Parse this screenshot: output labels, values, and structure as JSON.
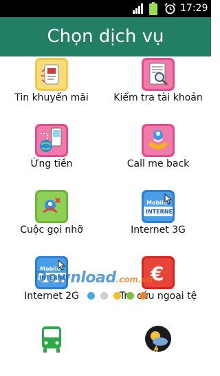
{
  "status_bar": {
    "time": "17:29",
    "icons": [
      "signal-icon",
      "battery-icon",
      "alarm-clock-icon"
    ]
  },
  "header": {
    "title": "Chọn dịch vụ"
  },
  "services": [
    {
      "label": "Tin khuyến mãi",
      "icon": "sim-card-promo-icon"
    },
    {
      "label": "Kiểm tra tài khoản",
      "icon": "document-magnifier-icon"
    },
    {
      "label": "Ứng tiền",
      "icon": "phone-globe-advance-icon"
    },
    {
      "label": "Call me back",
      "icon": "callback-handset-icon"
    },
    {
      "label": "Cuộc gọi nhỡ",
      "icon": "missed-call-icon"
    },
    {
      "label": "Internet 3G",
      "icon": "mobile-internet-3g-icon"
    },
    {
      "label": "Internet 2G",
      "icon": "mobile-internet-2g-icon"
    },
    {
      "label": "Tra cứu ngoại tệ",
      "icon": "euro-currency-icon"
    },
    {
      "label": "",
      "icon": "bus-icon"
    },
    {
      "label": "",
      "icon": "weather-icon"
    }
  ],
  "watermark": {
    "text": "Download",
    "suffix": ".com.vn"
  },
  "page_dots": {
    "colors": [
      "#4aa8e0",
      "#d0d0d0",
      "#f0c030",
      "#80c040",
      "#f08030"
    ]
  },
  "colors": {
    "header_bg": "#227f66",
    "status_bg": "#000000"
  }
}
